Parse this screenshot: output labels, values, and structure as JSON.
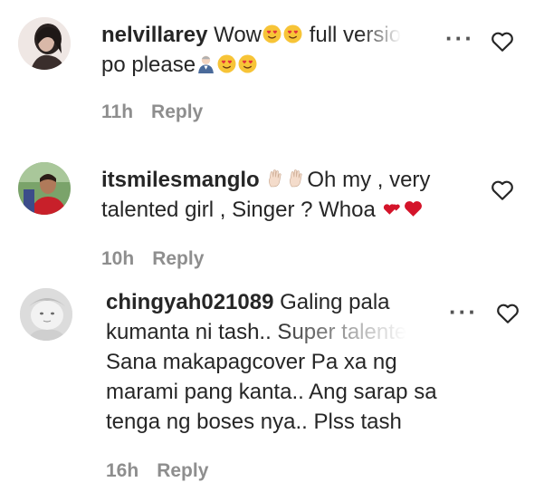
{
  "comments": [
    {
      "username": "nelvillarey",
      "text_line1_a": "Wow",
      "text_line1_b": "full versio",
      "text_line2": "po please",
      "emojis": [
        "smiling-heart-eyes-emoji",
        "smiling-heart-eyes-emoji",
        "person-bowing-emoji",
        "smiling-heart-eyes-emoji",
        "smiling-heart-eyes-emoji"
      ],
      "time": "11h",
      "reply": "Reply"
    },
    {
      "username": "itsmilesmanglo",
      "text_line1_b": "Oh my , very",
      "text_line2": "talented girl , Singer ? Whoa",
      "emojis": [
        "raised-hand-emoji",
        "raised-hand-emoji",
        "revolving-hearts-emoji",
        "red-heart-emoji"
      ],
      "time": "10h",
      "reply": "Reply"
    },
    {
      "username": "chingyah021089",
      "text_line1": "Galing pala",
      "text_line2": "kumanta ni tash.. Super talente",
      "text_line3": "Sana makapagcover Pa xa ng",
      "text_line4": "marami pang kanta.. Ang sarap sa",
      "text_line5": "tenga ng boses nya.. Plss tash",
      "time": "16h",
      "reply": "Reply"
    }
  ],
  "icons": {
    "more": "more-options-icon",
    "like": "heart-outline-icon"
  },
  "colors": {
    "text": "#262626",
    "meta": "#8e8e8e",
    "heart": "#d4142a",
    "emoji_yellow": "#f7c437"
  }
}
